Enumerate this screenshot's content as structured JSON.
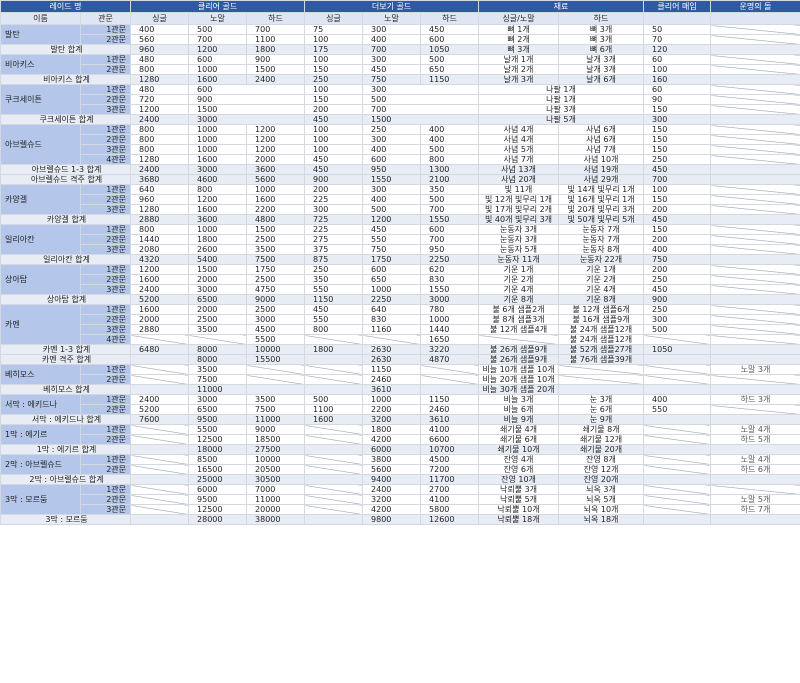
{
  "headers": {
    "raid_name": "레이드 명",
    "clear_gold": "클리어 골드",
    "more_gold": "더보기 골드",
    "materials": "재료",
    "clear_sell": "클리어 매입",
    "fate_stone": "운명의 돌"
  },
  "subheaders": [
    "이름",
    "관문",
    "싱글",
    "노말",
    "하드",
    "싱글",
    "노말",
    "하드",
    "싱글/노말",
    "하드",
    "",
    ""
  ],
  "rows": [
    {
      "t": "gate",
      "raid": "발탄",
      "span": 2,
      "gate": "1관문",
      "c": [
        "400",
        "500",
        "700",
        "75",
        "300",
        "450",
        "뼈 1개",
        "뼈 3개",
        "50",
        ""
      ]
    },
    {
      "t": "gate",
      "gate": "2관문",
      "c": [
        "560",
        "700",
        "1100",
        "100",
        "400",
        "600",
        "뼈 2개",
        "뼈 3개",
        "70",
        ""
      ]
    },
    {
      "t": "sum",
      "label": "발탄 합계",
      "c": [
        "960",
        "1200",
        "1800",
        "175",
        "700",
        "1050",
        "뼈 3개",
        "뼈 6개",
        "120",
        ""
      ]
    },
    {
      "t": "gate",
      "raid": "비아키스",
      "span": 2,
      "gate": "1관문",
      "c": [
        "480",
        "600",
        "900",
        "100",
        "300",
        "500",
        "날개 1개",
        "날개 3개",
        "60",
        ""
      ]
    },
    {
      "t": "gate",
      "gate": "2관문",
      "c": [
        "800",
        "1000",
        "1500",
        "150",
        "450",
        "650",
        "날개 2개",
        "날개 3개",
        "100",
        ""
      ]
    },
    {
      "t": "sum",
      "label": "비아키스 합계",
      "c": [
        "1280",
        "1600",
        "2400",
        "250",
        "750",
        "1150",
        "날개 3개",
        "날개 6개",
        "160",
        ""
      ]
    },
    {
      "t": "gate",
      "raid": "쿠크세이튼",
      "span": 3,
      "gate": "1관문",
      "m": [
        [
          "480",
          1
        ],
        [
          "600",
          2
        ],
        [
          "100",
          1
        ],
        [
          "300",
          2
        ],
        [
          "나팔 1개",
          2
        ],
        [
          "60",
          1
        ],
        [
          "",
          1
        ]
      ]
    },
    {
      "t": "gate",
      "gate": "2관문",
      "m": [
        [
          "720",
          1
        ],
        [
          "900",
          2
        ],
        [
          "150",
          1
        ],
        [
          "500",
          2
        ],
        [
          "나팔 1개",
          2
        ],
        [
          "90",
          1
        ],
        [
          "",
          1
        ]
      ]
    },
    {
      "t": "gate",
      "gate": "3관문",
      "m": [
        [
          "1200",
          1
        ],
        [
          "1500",
          2
        ],
        [
          "200",
          1
        ],
        [
          "700",
          2
        ],
        [
          "나팔 3개",
          2
        ],
        [
          "150",
          1
        ],
        [
          "",
          1
        ]
      ]
    },
    {
      "t": "sum",
      "label": "쿠크세이튼 합계",
      "m": [
        [
          "2400",
          1
        ],
        [
          "3000",
          2
        ],
        [
          "450",
          1
        ],
        [
          "1500",
          2
        ],
        [
          "나팔 5개",
          2
        ],
        [
          "300",
          1
        ],
        [
          "",
          1
        ]
      ]
    },
    {
      "t": "gate",
      "raid": "아브렐슈드",
      "span": 4,
      "gate": "1관문",
      "c": [
        "800",
        "1000",
        "1200",
        "100",
        "250",
        "400",
        "사념 4개",
        "사념 6개",
        "150",
        ""
      ]
    },
    {
      "t": "gate",
      "gate": "2관문",
      "c": [
        "800",
        "1000",
        "1200",
        "100",
        "300",
        "400",
        "사념 4개",
        "사념 6개",
        "150",
        ""
      ]
    },
    {
      "t": "gate",
      "gate": "3관문",
      "c": [
        "800",
        "1000",
        "1200",
        "100",
        "400",
        "500",
        "사념 5개",
        "사념 7개",
        "150",
        ""
      ]
    },
    {
      "t": "gate",
      "gate": "4관문",
      "c": [
        "1280",
        "1600",
        "2000",
        "450",
        "600",
        "800",
        "사념 7개",
        "사념 10개",
        "250",
        ""
      ]
    },
    {
      "t": "sum",
      "label": "아브렐슈드 1-3 합계",
      "c": [
        "2400",
        "3000",
        "3600",
        "450",
        "950",
        "1300",
        "사념 13개",
        "사념 19개",
        "450",
        ""
      ]
    },
    {
      "t": "sum",
      "label": "아브렐슈드 격주 합계",
      "c": [
        "3680",
        "4600",
        "5600",
        "900",
        "1550",
        "2100",
        "사념 20개",
        "사념 29개",
        "700",
        ""
      ]
    },
    {
      "t": "gate",
      "raid": "카양겔",
      "span": 3,
      "gate": "1관문",
      "c": [
        "640",
        "800",
        "1000",
        "200",
        "300",
        "350",
        "빛 11개",
        "빛 14개 빛무리 1개",
        "100",
        ""
      ]
    },
    {
      "t": "gate",
      "gate": "2관문",
      "c": [
        "960",
        "1200",
        "1600",
        "225",
        "400",
        "500",
        "빛 12개 빛무리 1개",
        "빛 16개 빛무리 1개",
        "150",
        ""
      ]
    },
    {
      "t": "gate",
      "gate": "3관문",
      "c": [
        "1280",
        "1600",
        "2200",
        "300",
        "500",
        "700",
        "빛 17개 빛무리 2개",
        "빛 20개 빛무리 3개",
        "200",
        ""
      ]
    },
    {
      "t": "sum",
      "label": "카양겔 합계",
      "c": [
        "2880",
        "3600",
        "4800",
        "725",
        "1200",
        "1550",
        "빛 40개 빛무리 3개",
        "빛 50개 빛무리 5개",
        "450",
        ""
      ]
    },
    {
      "t": "gate",
      "raid": "일리아칸",
      "span": 3,
      "gate": "1관문",
      "c": [
        "800",
        "1000",
        "1500",
        "225",
        "450",
        "600",
        "눈동자 3개",
        "눈동자 7개",
        "150",
        ""
      ]
    },
    {
      "t": "gate",
      "gate": "2관문",
      "c": [
        "1440",
        "1800",
        "2500",
        "275",
        "550",
        "700",
        "눈동자 3개",
        "눈동자 7개",
        "200",
        ""
      ]
    },
    {
      "t": "gate",
      "gate": "3관문",
      "c": [
        "2080",
        "2600",
        "3500",
        "375",
        "750",
        "950",
        "눈동자 5개",
        "눈동자 8개",
        "400",
        ""
      ]
    },
    {
      "t": "sum",
      "label": "일리아칸 합계",
      "c": [
        "4320",
        "5400",
        "7500",
        "875",
        "1750",
        "2250",
        "눈동자 11개",
        "눈동자 22개",
        "750",
        ""
      ]
    },
    {
      "t": "gate",
      "raid": "상아탑",
      "span": 3,
      "gate": "1관문",
      "c": [
        "1200",
        "1500",
        "1750",
        "250",
        "600",
        "620",
        "기운 1개",
        "기운 1개",
        "200",
        ""
      ]
    },
    {
      "t": "gate",
      "gate": "2관문",
      "c": [
        "1600",
        "2000",
        "2500",
        "350",
        "650",
        "830",
        "기운 2개",
        "기운 2개",
        "250",
        ""
      ]
    },
    {
      "t": "gate",
      "gate": "3관문",
      "c": [
        "2400",
        "3000",
        "4750",
        "550",
        "1000",
        "1550",
        "기운 4개",
        "기운 4개",
        "450",
        ""
      ]
    },
    {
      "t": "sum",
      "label": "상아탑 합계",
      "c": [
        "5200",
        "6500",
        "9000",
        "1150",
        "2250",
        "3000",
        "기운 8개",
        "기운 8개",
        "900",
        ""
      ]
    },
    {
      "t": "gate",
      "raid": "카멘",
      "span": 4,
      "gate": "1관문",
      "c": [
        "1600",
        "2000",
        "2500",
        "450",
        "640",
        "780",
        "불 6개 샘플2개",
        "불 12개 샘플6개",
        "250",
        ""
      ]
    },
    {
      "t": "gate",
      "gate": "2관문",
      "c": [
        "2000",
        "2500",
        "3000",
        "550",
        "830",
        "1000",
        "불 8개 샘플3개",
        "불 16개 샘플9개",
        "300",
        ""
      ]
    },
    {
      "t": "gate",
      "gate": "3관문",
      "c": [
        "2880",
        "3500",
        "4500",
        "800",
        "1160",
        "1440",
        "불 12개 샘플4개",
        "불 24개 샘플12개",
        "500",
        ""
      ]
    },
    {
      "t": "gate",
      "gate": "4관문",
      "c": [
        "",
        "",
        "5500",
        "",
        "",
        "1650",
        "",
        "불 24개 샘플12개",
        "",
        ""
      ]
    },
    {
      "t": "sum",
      "label": "카멘 1-3 합계",
      "c": [
        "6480",
        "8000",
        "10000",
        "1800",
        "2630",
        "3220",
        "불 26개 샘플9개",
        "불 52개 샘플27개",
        "1050",
        ""
      ]
    },
    {
      "t": "sum",
      "label": "카멘 격주 합계",
      "c": [
        "",
        "8000",
        "15500",
        "",
        "2630",
        "4870",
        "불 26개 샘플9개",
        "불 76개 샘플39개",
        "",
        ""
      ]
    },
    {
      "t": "gate",
      "raid": "베히모스",
      "span": 2,
      "gate": "1관문",
      "c": [
        "",
        "3500",
        "",
        "",
        "1150",
        "",
        "비늘 10개 샘플 10개",
        "",
        "",
        "노말 3개"
      ]
    },
    {
      "t": "gate",
      "gate": "2관문",
      "c": [
        "",
        "7500",
        "",
        "",
        "2460",
        "",
        "비늘 20개 샘플 10개",
        "",
        "",
        ""
      ]
    },
    {
      "t": "sum",
      "label": "베히모스 합계",
      "c": [
        "",
        "11000",
        "",
        "",
        "3610",
        "",
        "비늘 30개 샘플 20개",
        "",
        "",
        ""
      ]
    },
    {
      "t": "gate",
      "raid": "서막 : 에키드나",
      "span": 2,
      "gate": "1관문",
      "c": [
        "2400",
        "3000",
        "3500",
        "500",
        "1000",
        "1150",
        "비늘 3개",
        "눈 3개",
        "400",
        "하드 3개"
      ]
    },
    {
      "t": "gate",
      "gate": "2관문",
      "c": [
        "5200",
        "6500",
        "7500",
        "1100",
        "2200",
        "2460",
        "비늘 6개",
        "눈 6개",
        "550",
        ""
      ]
    },
    {
      "t": "sum",
      "label": "서막 : 에키드나 합계",
      "c": [
        "7600",
        "9500",
        "11000",
        "1600",
        "3200",
        "3610",
        "비늘 9개",
        "눈 9개",
        "",
        ""
      ]
    },
    {
      "t": "gate",
      "raid": "1막 : 에기르",
      "span": 2,
      "gate": "1관문",
      "c": [
        "",
        "5500",
        "9000",
        "",
        "1800",
        "4100",
        "쇄기물 4개",
        "쇄기물 8개",
        "",
        "노말 4개"
      ]
    },
    {
      "t": "gate",
      "gate": "2관문",
      "c": [
        "",
        "12500",
        "18500",
        "",
        "4200",
        "6600",
        "쇄기물 6개",
        "쇄기물 12개",
        "",
        "하드 5개"
      ]
    },
    {
      "t": "sum",
      "label": "1막 : 에기르 합계",
      "c": [
        "",
        "18000",
        "27500",
        "",
        "6000",
        "10700",
        "쇄기물 10개",
        "쇄기물 20개",
        "",
        ""
      ]
    },
    {
      "t": "gate",
      "raid": "2막 : 아브렐슈드",
      "span": 2,
      "gate": "1관문",
      "c": [
        "",
        "8500",
        "10000",
        "",
        "3800",
        "4500",
        "잔영 4개",
        "잔영 8개",
        "",
        "노말 4개"
      ]
    },
    {
      "t": "gate",
      "gate": "2관문",
      "c": [
        "",
        "16500",
        "20500",
        "",
        "5600",
        "7200",
        "잔영 6개",
        "잔영 12개",
        "",
        "하드 6개"
      ]
    },
    {
      "t": "sum",
      "label": "2막 : 아브렐슈드 합계",
      "c": [
        "",
        "25000",
        "30500",
        "",
        "9400",
        "11700",
        "잔영 10개",
        "잔영 20개",
        "",
        ""
      ]
    },
    {
      "t": "gate",
      "raid": "3막 : 모르둠",
      "span": 3,
      "gate": "1관문",
      "c": [
        "",
        "6000",
        "7000",
        "",
        "2400",
        "2700",
        "낙뢰뿔 3개",
        "뇌옥 3개",
        "",
        ""
      ]
    },
    {
      "t": "gate",
      "gate": "2관문",
      "c": [
        "",
        "9500",
        "11000",
        "",
        "3200",
        "4100",
        "낙뢰뿔 5개",
        "뇌옥 5개",
        "",
        "노말 5개"
      ]
    },
    {
      "t": "gate",
      "gate": "3관문",
      "c": [
        "",
        "12500",
        "20000",
        "",
        "4200",
        "5800",
        "낙뢰뿔 10개",
        "뇌옥 10개",
        "",
        "하드 7개"
      ]
    },
    {
      "t": "sum",
      "label": "3막 : 모르둠",
      "c": [
        "",
        "28000",
        "38000",
        "",
        "9800",
        "12600",
        "낙뢰뿔 18개",
        "뇌옥 18개",
        "",
        ""
      ]
    }
  ]
}
